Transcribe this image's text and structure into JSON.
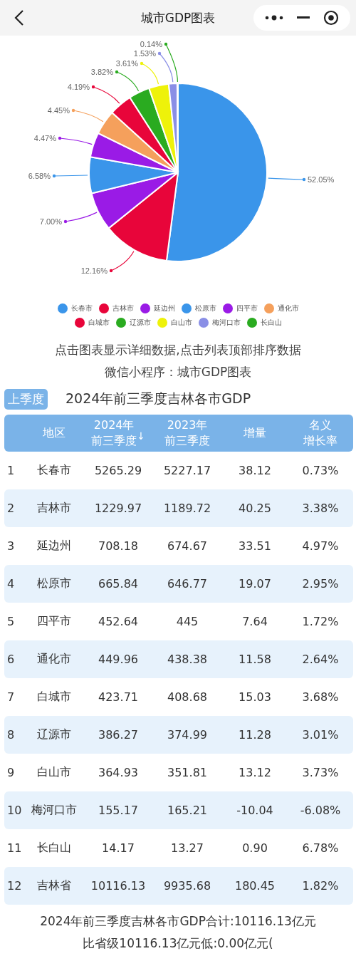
{
  "nav": {
    "title": "城市GDP图表"
  },
  "chart": {
    "chart_data": {
      "type": "pie",
      "categories": [
        "长春市",
        "吉林市",
        "延边州",
        "松原市",
        "四平市",
        "通化市",
        "白城市",
        "辽源市",
        "白山市",
        "梅河口市",
        "长白山"
      ],
      "values": [
        52.05,
        12.16,
        7.0,
        6.58,
        4.47,
        4.45,
        4.19,
        3.82,
        3.61,
        1.53,
        0.14
      ],
      "value_labels": [
        "52.05%",
        "12.16%",
        "7.00%",
        "6.58%",
        "4.47%",
        "4.45%",
        "4.19%",
        "3.82%",
        "3.61%",
        "1.53%",
        "0.14%"
      ]
    },
    "legend": [
      {
        "color": "#3a95ea"
      },
      {
        "color": "#e8053a"
      },
      {
        "color": "#9a1be6"
      },
      {
        "color": "#3a95ea"
      },
      {
        "color": "#9a1be6"
      },
      {
        "color": "#f5a05c"
      },
      {
        "color": "#e8053a"
      },
      {
        "color": "#2aab20"
      },
      {
        "color": "#eef20a"
      },
      {
        "color": "#8a8fe6"
      },
      {
        "color": "#2aab20"
      }
    ]
  },
  "notes": [
    "点击图表显示详细数据,点击列表顶部排序数据",
    "微信小程序：城市GDP图表"
  ],
  "period_button": "上季度",
  "table_title": "2024年前三季度吉林各市GDP",
  "table": {
    "columns": [
      {
        "kind": "index"
      },
      {
        "kind": "label",
        "lines": [
          "地区"
        ]
      },
      {
        "kind": "label",
        "lines": [
          "2024年",
          "前三季度"
        ],
        "sort_arrow": "↓"
      },
      {
        "kind": "label",
        "lines": [
          "2023年",
          "前三季度"
        ]
      },
      {
        "kind": "label",
        "lines": [
          "增量"
        ]
      },
      {
        "kind": "label",
        "lines": [
          "名义",
          "增长率"
        ]
      }
    ],
    "rows": [
      [
        "1",
        "长春市",
        "5265.29",
        "5227.17",
        "38.12",
        "0.73%"
      ],
      [
        "2",
        "吉林市",
        "1229.97",
        "1189.72",
        "40.25",
        "3.38%"
      ],
      [
        "3",
        "延边州",
        "708.18",
        "674.67",
        "33.51",
        "4.97%"
      ],
      [
        "4",
        "松原市",
        "665.84",
        "646.77",
        "19.07",
        "2.95%"
      ],
      [
        "5",
        "四平市",
        "452.64",
        "445",
        "7.64",
        "1.72%"
      ],
      [
        "6",
        "通化市",
        "449.96",
        "438.38",
        "11.58",
        "2.64%"
      ],
      [
        "7",
        "白城市",
        "423.71",
        "408.68",
        "15.03",
        "3.68%"
      ],
      [
        "8",
        "辽源市",
        "386.27",
        "374.99",
        "11.28",
        "3.01%"
      ],
      [
        "9",
        "白山市",
        "364.93",
        "351.81",
        "13.12",
        "3.73%"
      ],
      [
        "10",
        "梅河口市",
        "155.17",
        "165.21",
        "-10.04",
        "-6.08%"
      ],
      [
        "11",
        "长白山",
        "14.17",
        "13.27",
        "0.90",
        "6.78%"
      ],
      [
        "12",
        "吉林省",
        "10116.13",
        "9935.68",
        "180.45",
        "1.82%"
      ]
    ]
  },
  "summary": [
    "2024年前三季度吉林各市GDP合计:10116.13亿元",
    "比省级10116.13亿元低:0.00亿元("
  ]
}
